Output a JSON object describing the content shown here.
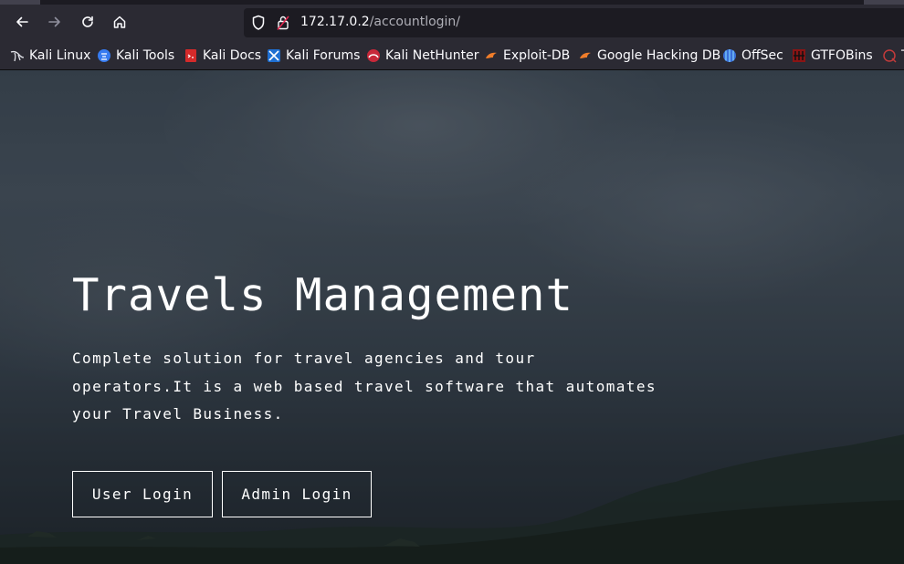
{
  "browser": {
    "url_host": "172.17.0.2",
    "url_path": "/accountlogin/",
    "nav": [
      "back-icon",
      "forward-icon",
      "reload-icon",
      "home-icon"
    ],
    "bookmarks": [
      {
        "label": "Kali Linux",
        "icon": "kali-dragon-icon"
      },
      {
        "label": "Kali Tools",
        "icon": "kali-tools-icon"
      },
      {
        "label": "Kali Docs",
        "icon": "kali-docs-icon"
      },
      {
        "label": "Kali Forums",
        "icon": "kali-forums-icon"
      },
      {
        "label": "Kali NetHunter",
        "icon": "nethunter-icon"
      },
      {
        "label": "Exploit-DB",
        "icon": "exploitdb-icon"
      },
      {
        "label": "Google Hacking DB",
        "icon": "ghdb-icon"
      },
      {
        "label": "OffSec",
        "icon": "offsec-icon"
      },
      {
        "label": "GTFOBins",
        "icon": "gtfobins-icon"
      },
      {
        "label": "T",
        "icon": "truncated-bookmark-icon"
      }
    ]
  },
  "hero": {
    "title": "Travels Management",
    "description": "Complete solution for travel agencies and tour operators.It is a web based travel software that automates your Travel Business.",
    "user_login_label": "User Login",
    "admin_login_label": "Admin Login"
  }
}
